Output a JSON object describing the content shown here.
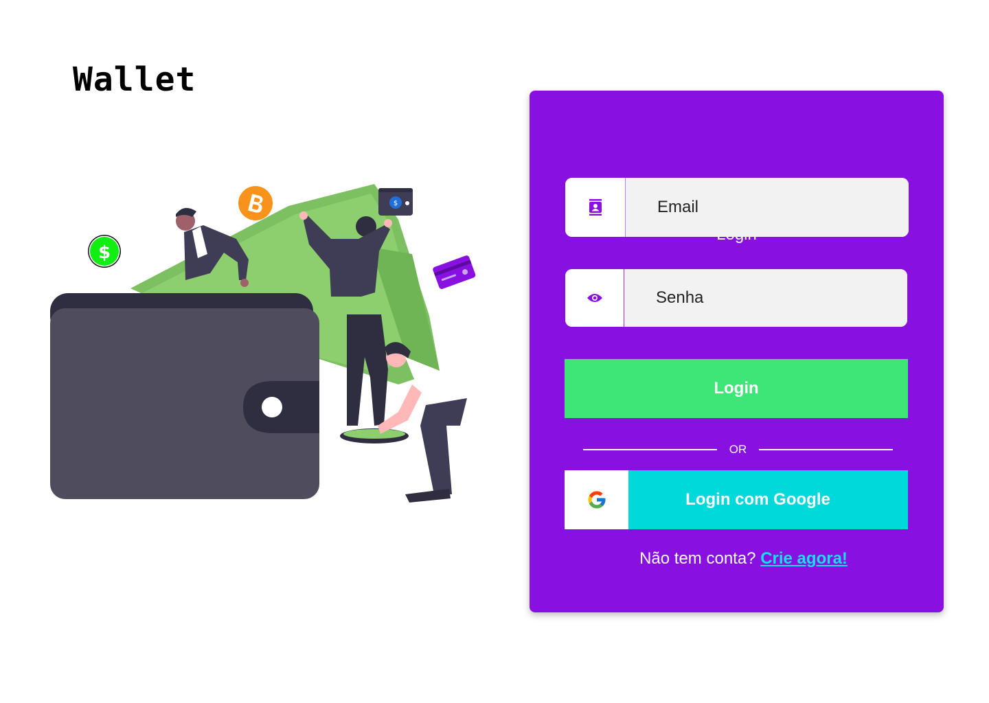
{
  "app": {
    "brand": "Wallet"
  },
  "login_card": {
    "title": "Login",
    "email": {
      "placeholder": "Email",
      "icon": "contact-card-icon"
    },
    "password": {
      "placeholder": "Senha",
      "icon": "eye-icon"
    },
    "login_button": "Login",
    "divider_text": "OR",
    "google_button": {
      "label": "Login com Google",
      "icon": "google-icon"
    },
    "signup_prompt": "Não tem conta?",
    "signup_link": "Crie agora!"
  },
  "illustration": {
    "dollar_symbol": "$",
    "icons": [
      "dollar-coin-icon",
      "bitcoin-icon",
      "mini-wallet-icon",
      "credit-card-icon"
    ]
  },
  "colors": {
    "card_bg": "#8810e0",
    "login_button": "#3ee577",
    "google_button": "#00d9d9",
    "signup_link": "#18e0f0",
    "wallet": "#4f4d5d",
    "money": "#8dce6e"
  }
}
